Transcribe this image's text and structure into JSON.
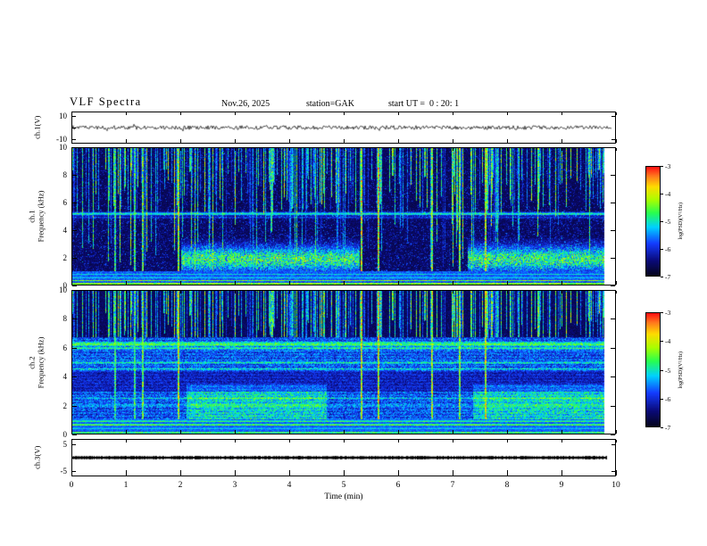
{
  "header": {
    "title": "VLF Spectra",
    "date": "Nov.26, 2025",
    "station": "station=GAK",
    "start_ut": "start UT =  0 : 20: 1"
  },
  "axes": {
    "x": {
      "label": "Time (min)",
      "ticks": [
        "0",
        "1",
        "2",
        "3",
        "4",
        "5",
        "6",
        "7",
        "8",
        "9",
        "10"
      ]
    },
    "wave1": {
      "label": "ch.1(V)",
      "ticks": [
        "10",
        "-10"
      ]
    },
    "spec1": {
      "channel": "ch.1",
      "label": "Frequency (kHz)",
      "ticks": [
        "10",
        "8",
        "6",
        "4",
        "2",
        "0"
      ]
    },
    "spec2": {
      "channel": "ch.2",
      "label": "Frequency (kHz)",
      "ticks": [
        "10",
        "8",
        "6",
        "4",
        "2",
        "0"
      ]
    },
    "wave3": {
      "label": "ch.3(V)",
      "ticks": [
        "5",
        "-5"
      ]
    }
  },
  "colorbar": {
    "label": "log(PSD)(V²/Hz)",
    "ticks": [
      "-3",
      "-4",
      "-5",
      "-6",
      "-7"
    ]
  },
  "chart_data": [
    {
      "type": "line",
      "panel": "ch.1(V)",
      "xlabel": "Time (min)",
      "x_range": [
        0,
        9.8
      ],
      "ylim": [
        -10,
        10
      ],
      "series": [
        {
          "name": "ch.1 voltage",
          "summary": "continuous noise-like trace centered at 0 V, fluctuations about ±1.5 V over the full 0–9.8 min record"
        }
      ]
    },
    {
      "type": "heatmap",
      "panel": "ch.1 spectrogram",
      "xlabel": "Time (min)",
      "ylabel": "Frequency (kHz)",
      "x_range": [
        0,
        9.8
      ],
      "ylim": [
        0,
        10
      ],
      "zlabel": "log(PSD)(V²/Hz)",
      "zlim": [
        -7,
        -3
      ],
      "features": [
        "dark background near -7 above 5.5 kHz",
        "dense vertical sferic streaks descending from 10 kHz to 4-7 kHz at about -5 to -4",
        "continuous narrow spectral line at about 5.2 kHz",
        "diffuse 1-3 kHz enhancement during about 2-5.3 min and 7.3-9.8 min",
        "bright horizontal bands below 1 kHz reaching about -3.5"
      ]
    },
    {
      "type": "heatmap",
      "panel": "ch.2 spectrogram",
      "xlabel": "Time (min)",
      "ylabel": "Frequency (kHz)",
      "x_range": [
        0,
        9.8
      ],
      "ylim": [
        0,
        10
      ],
      "zlabel": "log(PSD)(V²/Hz)",
      "zlim": [
        -7,
        -3
      ],
      "features": [
        "broadband enhancement near -5 below 5 kHz for the entire record",
        "horizontal spectral lines at about 6.3, 6.0, 5.0 and 4.6 kHz",
        "vertical sferic streaks above 7 kHz",
        "bright bands below 1 kHz at about -3.5 to -4"
      ]
    },
    {
      "type": "line",
      "panel": "ch.3(V)",
      "xlabel": "Time (min)",
      "x_range": [
        0,
        9.8
      ],
      "ylim": [
        -5,
        5
      ],
      "series": [
        {
          "name": "ch.3 voltage",
          "summary": "flat thick trace at about 0 V for the entire record"
        }
      ]
    }
  ]
}
